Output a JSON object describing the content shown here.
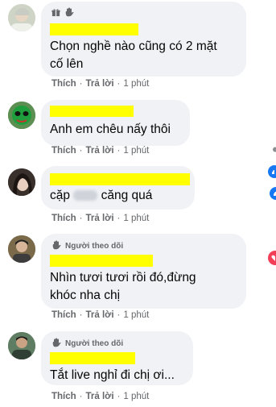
{
  "comments": [
    {
      "badge_label": "",
      "text_lines": [
        "Chọn nghề nào cũng có 2 mặt",
        "cố lên"
      ],
      "actions": {
        "like": "Thích",
        "reply": "Trả lời",
        "time": "1 phút"
      }
    },
    {
      "text_lines": [
        "Anh em chêu nấy thôi"
      ],
      "actions": {
        "like": "Thích",
        "reply": "Trả lời",
        "time": "1 phút"
      }
    },
    {
      "text_before": "cặp",
      "text_after": "căng quá",
      "actions": {
        "like": "Thích",
        "reply": "Trả lời",
        "time": "1 phút"
      }
    },
    {
      "badge_label": "Người theo dõi",
      "text_lines": [
        "Nhìn tươi tươi rồi đó,đừng",
        "khóc nha chị"
      ],
      "actions": {
        "like": "Thích",
        "reply": "Trả lời",
        "time": "1 phút"
      }
    },
    {
      "badge_label": "Người theo dõi",
      "text_lines": [
        "Tắt live nghỉ đi chị ơi..."
      ],
      "actions": {
        "like": "Thích",
        "reply": "Trả lời",
        "time": "1 phút"
      }
    }
  ],
  "separator": "·",
  "colors": {
    "bubble": "#f0f2f5",
    "highlight": "#ffff00",
    "secondary_text": "#65676b",
    "like_blue": "#1877f2",
    "love_red": "#f33e58"
  },
  "icons": [
    "gift-icon",
    "wave-icon",
    "like-reaction-icon",
    "love-reaction-icon"
  ]
}
